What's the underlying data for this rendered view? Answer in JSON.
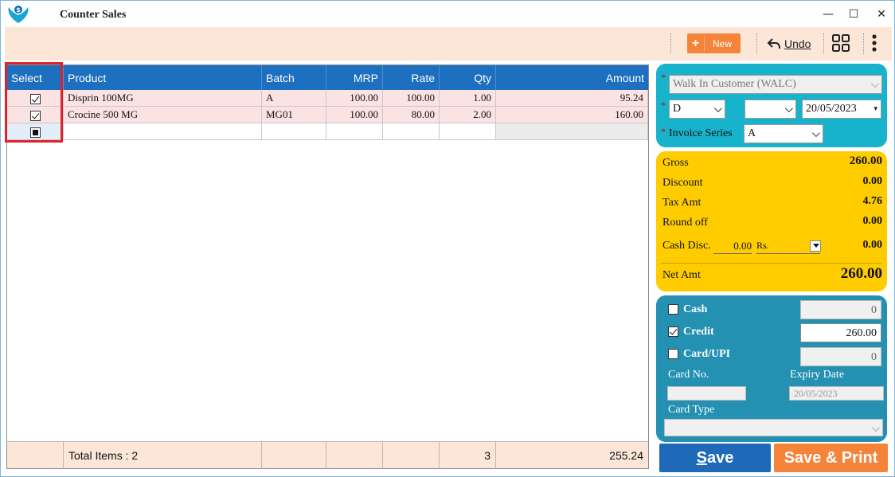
{
  "window": {
    "title": "Counter Sales",
    "minimize_symbol": "—",
    "maximize_symbol": "☐",
    "close_symbol": "✕"
  },
  "toolbar": {
    "new_plus": "+",
    "new_label": "New",
    "undo_label": "Undo"
  },
  "grid": {
    "columns": [
      "Select",
      "Product",
      "Batch",
      "MRP",
      "Rate",
      "Qty",
      "Amount"
    ],
    "rows": [
      {
        "selected": true,
        "product": "Disprin 100MG",
        "batch": "A",
        "mrp": "100.00",
        "rate": "100.00",
        "qty": "1.00",
        "amount": "95.24"
      },
      {
        "selected": true,
        "product": "Crocine 500 MG",
        "batch": "MG01",
        "mrp": "100.00",
        "rate": "80.00",
        "qty": "2.00",
        "amount": "160.00"
      }
    ],
    "footer": {
      "total_items": "Total Items : 2",
      "qty": "3",
      "amount": "255.24"
    }
  },
  "customer": {
    "customer_value": "Walk In Customer (WALC)",
    "type_value": "D",
    "blank_select": "",
    "date_value": "20/05/2023",
    "invoice_series_label": "Invoice Series",
    "invoice_series_value": "A",
    "required_mark": "*"
  },
  "summary": {
    "gross_label": "Gross",
    "gross_value": "260.00",
    "discount_label": "Discount",
    "discount_value": "0.00",
    "tax_label": "Tax Amt",
    "tax_value": "4.76",
    "roundoff_label": "Round off",
    "roundoff_value": "0.00",
    "cashdisc_label": "Cash Disc.",
    "cashdisc_input": "0.00",
    "cashdisc_unit": "Rs.",
    "cashdisc_value": "0.00",
    "net_label": "Net Amt",
    "net_value": "260.00"
  },
  "payment": {
    "cash_label": "Cash",
    "cash_checked": false,
    "cash_value": "0",
    "credit_label": "Credit",
    "credit_checked": true,
    "credit_value": "260.00",
    "card_label": "Card/UPI",
    "card_checked": false,
    "card_value": "0",
    "card_no_label": "Card No.",
    "expiry_label": "Expiry Date",
    "expiry_value": "20/05/2023",
    "card_type_label": "Card Type"
  },
  "actions": {
    "save_first": "S",
    "save_rest": "ave",
    "save_print": "Save & Print"
  },
  "colors": {
    "header_blue": "#1d6fbf",
    "accent_orange": "#f5843a",
    "cyan_panel": "#17b2cc",
    "yellow_panel": "#ffcc00",
    "teal_panel": "#2490b2",
    "row_pink": "#fce3e3",
    "toolbar_peach": "#fbe6d8",
    "highlight_red": "#e0202a"
  }
}
